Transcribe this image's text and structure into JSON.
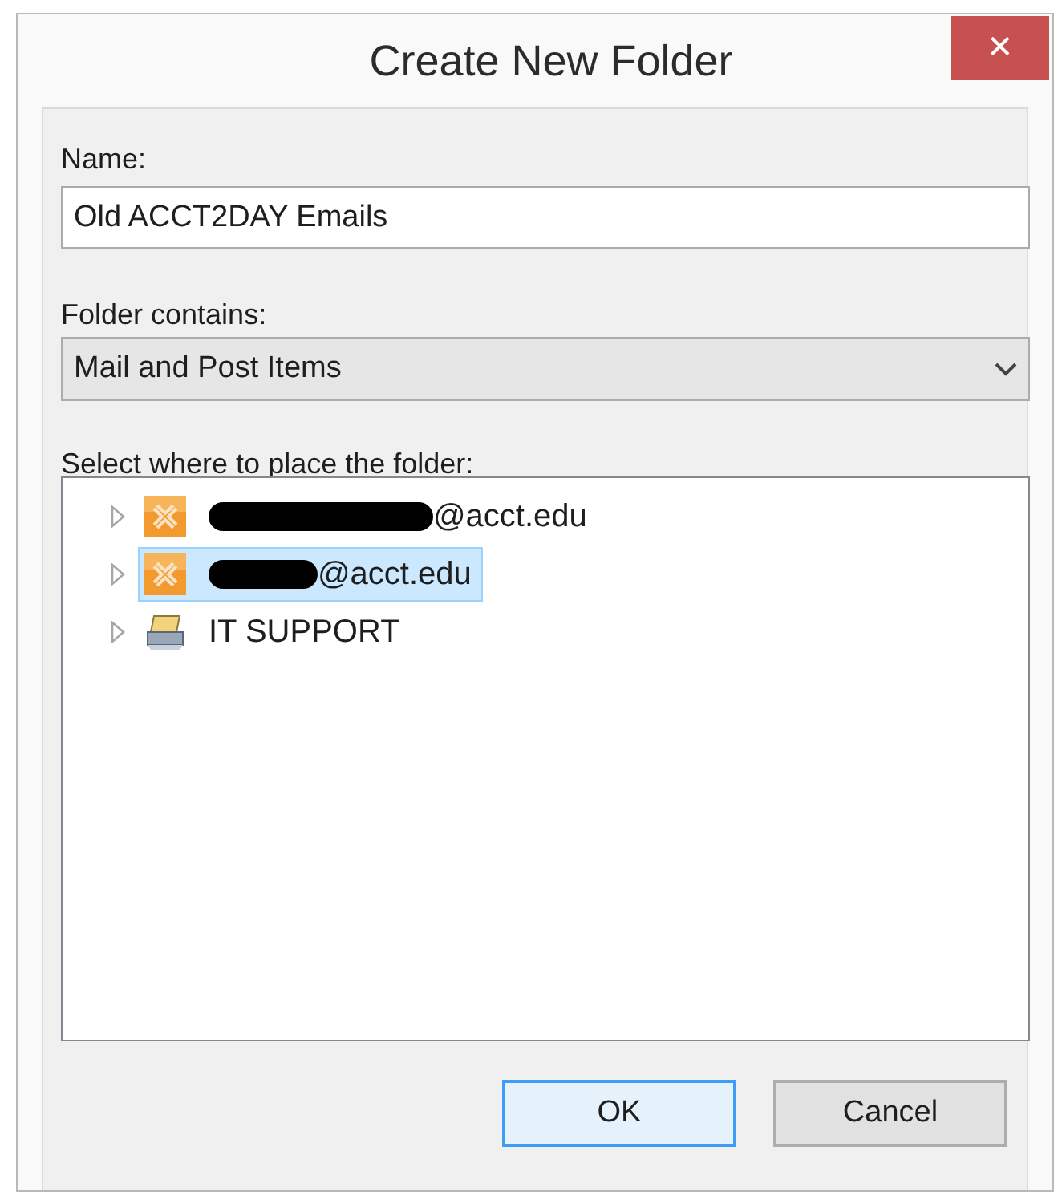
{
  "window": {
    "title": "Create New Folder",
    "close": "✕"
  },
  "name_field": {
    "label": "Name:",
    "value": "Old ACCT2DAY Emails"
  },
  "folder_contains": {
    "label": "Folder contains:",
    "value": "Mail and Post Items"
  },
  "tree": {
    "label": "Select where to place the folder:",
    "items": [
      {
        "kind": "mailbox",
        "text": "@acct.edu",
        "redacted": true,
        "long_redaction": true,
        "selected": false,
        "expanded": false
      },
      {
        "kind": "mailbox",
        "text": "@acct.edu",
        "redacted": true,
        "long_redaction": false,
        "selected": true,
        "expanded": false
      },
      {
        "kind": "archive",
        "text": "IT SUPPORT",
        "redacted": false,
        "selected": false,
        "expanded": false
      }
    ]
  },
  "buttons": [
    {
      "label": "OK",
      "default": true
    },
    {
      "label": "Cancel",
      "default": false
    }
  ]
}
